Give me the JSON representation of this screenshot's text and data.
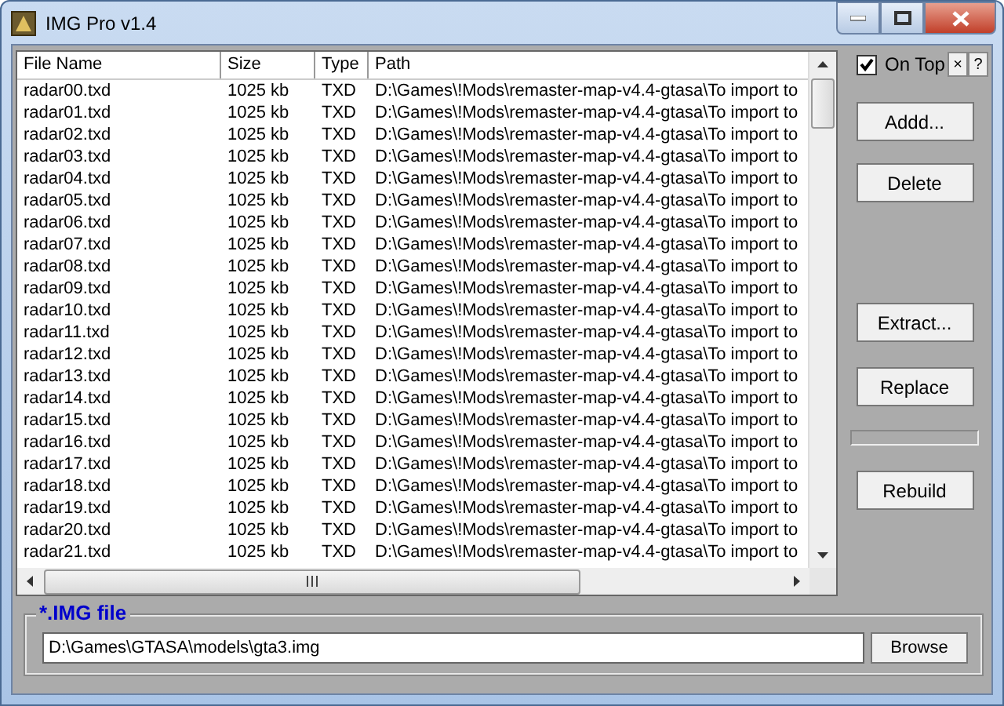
{
  "window": {
    "title": "IMG Pro v1.4"
  },
  "table": {
    "columns": [
      "File Name",
      "Size",
      "Type",
      "Path"
    ],
    "rows": [
      {
        "name": "radar00.txd",
        "size": "1025 kb",
        "type": "TXD",
        "path": "D:\\Games\\!Mods\\remaster-map-v4.4-gtasa\\To import to"
      },
      {
        "name": "radar01.txd",
        "size": "1025 kb",
        "type": "TXD",
        "path": "D:\\Games\\!Mods\\remaster-map-v4.4-gtasa\\To import to"
      },
      {
        "name": "radar02.txd",
        "size": "1025 kb",
        "type": "TXD",
        "path": "D:\\Games\\!Mods\\remaster-map-v4.4-gtasa\\To import to"
      },
      {
        "name": "radar03.txd",
        "size": "1025 kb",
        "type": "TXD",
        "path": "D:\\Games\\!Mods\\remaster-map-v4.4-gtasa\\To import to"
      },
      {
        "name": "radar04.txd",
        "size": "1025 kb",
        "type": "TXD",
        "path": "D:\\Games\\!Mods\\remaster-map-v4.4-gtasa\\To import to"
      },
      {
        "name": "radar05.txd",
        "size": "1025 kb",
        "type": "TXD",
        "path": "D:\\Games\\!Mods\\remaster-map-v4.4-gtasa\\To import to"
      },
      {
        "name": "radar06.txd",
        "size": "1025 kb",
        "type": "TXD",
        "path": "D:\\Games\\!Mods\\remaster-map-v4.4-gtasa\\To import to"
      },
      {
        "name": "radar07.txd",
        "size": "1025 kb",
        "type": "TXD",
        "path": "D:\\Games\\!Mods\\remaster-map-v4.4-gtasa\\To import to"
      },
      {
        "name": "radar08.txd",
        "size": "1025 kb",
        "type": "TXD",
        "path": "D:\\Games\\!Mods\\remaster-map-v4.4-gtasa\\To import to"
      },
      {
        "name": "radar09.txd",
        "size": "1025 kb",
        "type": "TXD",
        "path": "D:\\Games\\!Mods\\remaster-map-v4.4-gtasa\\To import to"
      },
      {
        "name": "radar10.txd",
        "size": "1025 kb",
        "type": "TXD",
        "path": "D:\\Games\\!Mods\\remaster-map-v4.4-gtasa\\To import to"
      },
      {
        "name": "radar11.txd",
        "size": "1025 kb",
        "type": "TXD",
        "path": "D:\\Games\\!Mods\\remaster-map-v4.4-gtasa\\To import to"
      },
      {
        "name": "radar12.txd",
        "size": "1025 kb",
        "type": "TXD",
        "path": "D:\\Games\\!Mods\\remaster-map-v4.4-gtasa\\To import to"
      },
      {
        "name": "radar13.txd",
        "size": "1025 kb",
        "type": "TXD",
        "path": "D:\\Games\\!Mods\\remaster-map-v4.4-gtasa\\To import to"
      },
      {
        "name": "radar14.txd",
        "size": "1025 kb",
        "type": "TXD",
        "path": "D:\\Games\\!Mods\\remaster-map-v4.4-gtasa\\To import to"
      },
      {
        "name": "radar15.txd",
        "size": "1025 kb",
        "type": "TXD",
        "path": "D:\\Games\\!Mods\\remaster-map-v4.4-gtasa\\To import to"
      },
      {
        "name": "radar16.txd",
        "size": "1025 kb",
        "type": "TXD",
        "path": "D:\\Games\\!Mods\\remaster-map-v4.4-gtasa\\To import to"
      },
      {
        "name": "radar17.txd",
        "size": "1025 kb",
        "type": "TXD",
        "path": "D:\\Games\\!Mods\\remaster-map-v4.4-gtasa\\To import to"
      },
      {
        "name": "radar18.txd",
        "size": "1025 kb",
        "type": "TXD",
        "path": "D:\\Games\\!Mods\\remaster-map-v4.4-gtasa\\To import to"
      },
      {
        "name": "radar19.txd",
        "size": "1025 kb",
        "type": "TXD",
        "path": "D:\\Games\\!Mods\\remaster-map-v4.4-gtasa\\To import to"
      },
      {
        "name": "radar20.txd",
        "size": "1025 kb",
        "type": "TXD",
        "path": "D:\\Games\\!Mods\\remaster-map-v4.4-gtasa\\To import to"
      },
      {
        "name": "radar21.txd",
        "size": "1025 kb",
        "type": "TXD",
        "path": "D:\\Games\\!Mods\\remaster-map-v4.4-gtasa\\To import to"
      }
    ]
  },
  "side_panel": {
    "on_top": {
      "label": "On Top",
      "checked": true
    },
    "small_buttons": [
      "×",
      "?"
    ],
    "top_buttons": [
      "Addd...",
      "Delete"
    ],
    "bottom_buttons": [
      "Extract...",
      "Replace"
    ],
    "progress": {
      "level": 0
    },
    "rebuild": "Rebuild"
  },
  "img_file": {
    "title": "*.IMG file",
    "value": "D:\\Games\\GTASA\\models\\gta3.img",
    "browse": "Browse"
  }
}
